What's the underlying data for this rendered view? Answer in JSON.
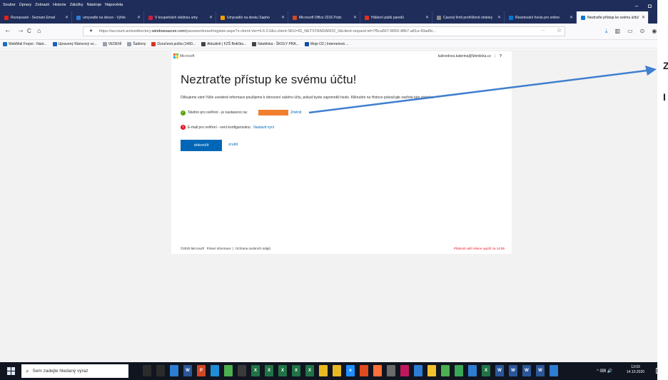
{
  "menubar": {
    "items": [
      "Soubor",
      "Úpravy",
      "Zobrazit",
      "Historie",
      "Záložky",
      "Nástroje",
      "Nápověda"
    ]
  },
  "window_controls": {
    "minimize": "–",
    "restore": "◘"
  },
  "tabs": [
    {
      "label": "Rozepsané - Seznam Email",
      "color": "#e2231a"
    },
    {
      "label": "umyvadlo na desce - Vyhle",
      "color": "#2f7bd8"
    },
    {
      "label": "V koupelnách vládnou umy",
      "color": "#d21f3c"
    },
    {
      "label": "Umyvadlo na desku Sapho",
      "color": "#f0a000"
    },
    {
      "label": "Microsoft Office 2016 Podc",
      "color": "#d24726"
    },
    {
      "label": "Hlášení pádů panelů",
      "color": "#e0301e"
    },
    {
      "label": "Časový limit prohlížené stránky",
      "color": "#888888"
    },
    {
      "label": "Resetování hesla pro online",
      "color": "#0078d4"
    },
    {
      "label": "Neztraťte přístup ke svému účtu!",
      "color": "#0078d4",
      "active": true
    }
  ],
  "nav": {
    "url_prefix": "https://account.activedirectory.",
    "url_domain": "windowsazure.com",
    "url_rest": "/passwordreset/register.aspx?x-client-Ver=6.6.0.0&x-client-SKU=ID_NETSTANDARD2_0&client-request-id=7f5ca567-8650-48b7-a81a-43ad9c...",
    "back": "←",
    "forward": "→",
    "reload": "C",
    "home": "⌂",
    "more": "···",
    "star": "☆"
  },
  "bookmarks": [
    {
      "label": "WebMail Forpsi - Nást...",
      "color": "#1d6ec2"
    },
    {
      "label": "Upravený Rámcový vz...",
      "color": "#1f5fbd"
    },
    {
      "label": "VEDENÍ",
      "color": "#9aa0aa"
    },
    {
      "label": "Šablony",
      "color": "#9aa0aa"
    },
    {
      "label": "Doručená pošta (1460...",
      "color": "#d93025"
    },
    {
      "label": "Aktuálně | FZŠ Brdičko...",
      "color": "#444444"
    },
    {
      "label": "Nástěnka - ŠKOLY PRA...",
      "color": "#444444"
    },
    {
      "label": "Moje O2 | Internetová ...",
      "color": "#0f4fa8"
    }
  ],
  "page": {
    "brand": "Microsoft",
    "account": "kalivodova.katerina@fzbrdicka.cz",
    "help": "?",
    "headline": "Neztraťte přístup ke svému účtu!",
    "description": "Děkujeme vám! Níže uvedené informace použijeme k obnovení vašeho účtu, pokud byste zapomněli heslo. Kliknutím na Hotovo pokračujte zavřete tuto stránku.",
    "phone_label": "Telefon pro ověření - je nastaveno na:",
    "phone_change": "Změnit",
    "email_label": "E-mail pro ověření - není konfigurováno.",
    "email_setup": "Nastavit nyní",
    "done_button": "dokončit",
    "cancel_link": "zrušit",
    "footer_copyright": "©2020 Microsoft",
    "footer_legal": "Právní informace",
    "footer_sep": "|",
    "footer_privacy": "Ochrana osobních údajů",
    "footer_session": "Platnost vaší relace vyprší za 14:56"
  },
  "side_text": {
    "line1": "Z",
    "line2": "I"
  },
  "taskbar": {
    "search_placeholder": "Sem zadejte hledaný výraz",
    "apps": [
      {
        "label": "",
        "color": "#2b2b2b"
      },
      {
        "label": "",
        "color": "#2b2b2b"
      },
      {
        "label": "",
        "color": "#2d7dd2"
      },
      {
        "label": "W",
        "color": "#2b579a"
      },
      {
        "label": "P",
        "color": "#d24726"
      },
      {
        "label": "",
        "color": "#1f8dd6"
      },
      {
        "label": "",
        "color": "#4caf50"
      },
      {
        "label": "",
        "color": "#3a3a3a"
      },
      {
        "label": "X",
        "color": "#217346"
      },
      {
        "label": "X",
        "color": "#217346"
      },
      {
        "label": "X",
        "color": "#217346"
      },
      {
        "label": "X",
        "color": "#217346"
      },
      {
        "label": "X",
        "color": "#217346"
      },
      {
        "label": "",
        "color": "#e8b923"
      },
      {
        "label": "",
        "color": "#e8b923"
      },
      {
        "label": "e",
        "color": "#1e90ff"
      },
      {
        "label": "",
        "color": "#e04a1f"
      },
      {
        "label": "",
        "color": "#ff7139"
      },
      {
        "label": "",
        "color": "#6b6b6b"
      },
      {
        "label": "",
        "color": "#c2185b"
      },
      {
        "label": "",
        "color": "#2d7dd2"
      },
      {
        "label": "",
        "color": "#f2c12e"
      },
      {
        "label": "",
        "color": "#4caf50"
      },
      {
        "label": "",
        "color": "#3aa757"
      },
      {
        "label": "",
        "color": "#2d7dd2"
      },
      {
        "label": "X",
        "color": "#217346"
      },
      {
        "label": "W",
        "color": "#2b579a"
      },
      {
        "label": "W",
        "color": "#2b579a"
      },
      {
        "label": "W",
        "color": "#2b579a"
      },
      {
        "label": "W",
        "color": "#2b579a"
      },
      {
        "label": "",
        "color": "#2d7dd2"
      }
    ],
    "tray": "^ ⌨ 🔊",
    "time": "13:03",
    "date": "14.10.2020"
  }
}
